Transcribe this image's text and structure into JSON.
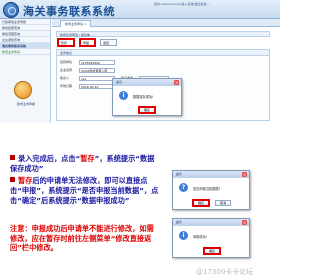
{
  "app": {
    "title": "海关事务联系系统",
    "user_info": "您好:xxxxxxxxxxx|进入系统|退出系统 ..."
  },
  "sidebar": {
    "items": [
      {
        "label": "行政审批业务申报"
      },
      {
        "label": "审批结果查询"
      },
      {
        "label": "审批流程查询"
      },
      {
        "label": "企业通知查询"
      },
      {
        "label": "海关事务联系系统"
      },
      {
        "label": "新增业务申请"
      }
    ],
    "big_icon_label": "新增业务申报"
  },
  "main": {
    "tab": "新增业务申请 ×",
    "panel_title": "新增业务申请 / 报关单 ...",
    "toolbar": {
      "save_label": "暂存",
      "submit_label": "申报",
      "back_label": "返回"
    },
    "form_title": "业务信息",
    "fields": [
      {
        "label": "经营单位",
        "value": "1105430290"
      },
      {
        "label": "企业名称",
        "value": "XXXX科技有限公司"
      },
      {
        "label": "联系人",
        "value": "xxx"
      },
      {
        "label": "联系电话",
        "value": "13901011111"
      },
      {
        "label": "有效日期",
        "value": "2016-05-10"
      },
      {
        "label": "申请日期",
        "value": "2016-05-..."
      }
    ]
  },
  "dialogs": {
    "saved": {
      "title": "提示",
      "message": "数据保存成功!",
      "ok_label": "确定"
    },
    "confirm": {
      "title": "提示",
      "message": "是否申报当前数据?",
      "ok_label": "确定",
      "cancel_label": "取消"
    },
    "declared": {
      "title": "提示",
      "message": "申报成功!",
      "ok_label": "确定"
    }
  },
  "instructions": {
    "step1_a": "录入完成后，点击“",
    "step1_b": "暂存",
    "step1_c": "”，系统提示“数据保存成功”",
    "step2_a": "暂存",
    "step2_b": "后的申请单无法修改，即可以直接点击“申报”，系统提示“是否申报当前数据”，点击“确定”后系统提示“数据申报成功”",
    "note": "注意：申报成功后申请单不能进行修改，如需修改，应在暂存时前往左侧菜单“修改直接返回”栏中修改。"
  },
  "watermark": "@17300卡卡论坛"
}
